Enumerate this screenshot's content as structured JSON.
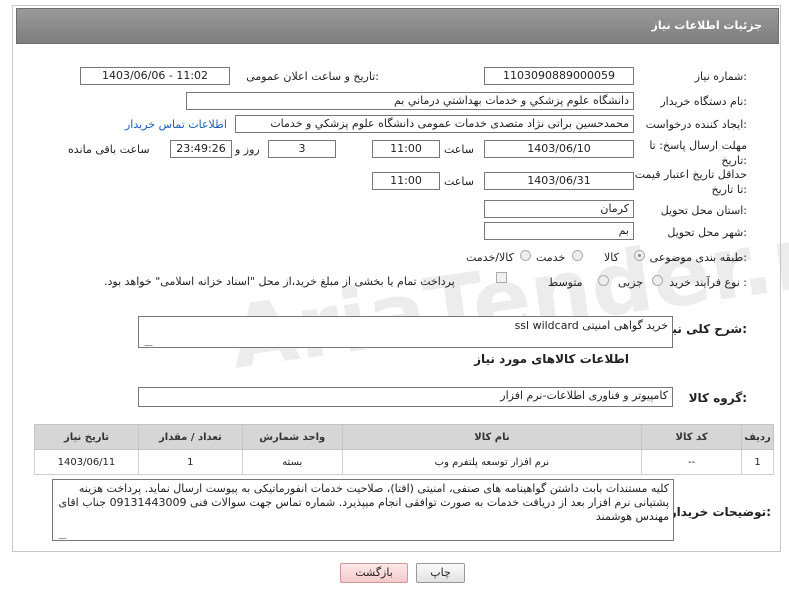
{
  "header": {
    "title": "جزئیات اطلاعات نیاز"
  },
  "watermark": "AriaTender.neT",
  "fields": {
    "need_number_label": "شماره نیاز:",
    "need_number": "1103090889000059",
    "announce_label": "تاریخ و ساعت اعلان عمومی:",
    "announce_value": "1403/06/06 - 11:02",
    "buyer_org_label": "نام دستگاه خریدار:",
    "buyer_org": "دانشگاه علوم پزشکي و خدمات بهداشتي  درماني بم",
    "requester_label": "ایجاد کننده درخواست:",
    "requester": "محمدحسین براتی نژاد متصدی خدمات عمومی دانشگاه علوم پزشکي و خدمات",
    "buyer_contact_link": "اطلاعات تماس خریدار",
    "reply_deadline_label": "مهلت ارسال پاسخ: تا تاریخ:",
    "reply_date": "1403/06/10",
    "time_label": "ساعت",
    "reply_time": "11:00",
    "days_value": "3",
    "days_label": "روز و",
    "remaining_time": "23:49:26",
    "remaining_label": "ساعت باقی مانده",
    "price_validity_label": "حداقل تاریخ اعتبار قیمت: تا تاریخ:",
    "price_date": "1403/06/31",
    "price_time": "11:00",
    "province_label": "استان محل تحویل:",
    "province": "کرمان",
    "city_label": "شهر محل تحویل:",
    "city": "بم",
    "category_label": "طبقه بندی موضوعی:",
    "cat_goods": "کالا",
    "cat_service": "خدمت",
    "cat_goods_service": "کالا/خدمت",
    "purchase_type_label": "نوع فرآیند خرید :",
    "pt_minor": "جزیی",
    "pt_medium": "متوسط",
    "payment_note": "پرداخت تمام یا بخشی از مبلغ خرید،از محل \"اسناد خزانه اسلامی\" خواهد بود."
  },
  "description": {
    "label": "شرح کلی نیاز:",
    "value": "خرید گواهی امنیتی ssl wildcard"
  },
  "goods_info_title": "اطلاعات کالاهای مورد نیاز",
  "goods_group": {
    "label": "گروه کالا:",
    "value": "کامپیوتر و فناوری اطلاعات-نرم افزار"
  },
  "table": {
    "headers": [
      "ردیف",
      "کد کالا",
      "نام کالا",
      "واحد شمارش",
      "تعداد / مقدار",
      "تاریخ نیاز"
    ],
    "rows": [
      [
        "1",
        "--",
        "نرم افزار توسعه پلتفرم وب",
        "بسته",
        "1",
        "1403/06/11"
      ]
    ]
  },
  "buyer_notes": {
    "label": "توضیحات خریدار:",
    "value": "کلیه مستندات بابت داشتن گواهینامه های صنفی، امنیتی (افتا)، صلاحیت خدمات انفورماتیکی به پیوست ارسال نماید. پرداخت هزینه پشتیانی نرم افزار بعد از دریافت خدمات به صورت توافقی انجام میپذیرد. شماره تماس جهت سوالات فنی 09131443009 جناب اقای مهندس هوشمند"
  },
  "buttons": {
    "print": "چاپ",
    "back": "بازگشت"
  }
}
